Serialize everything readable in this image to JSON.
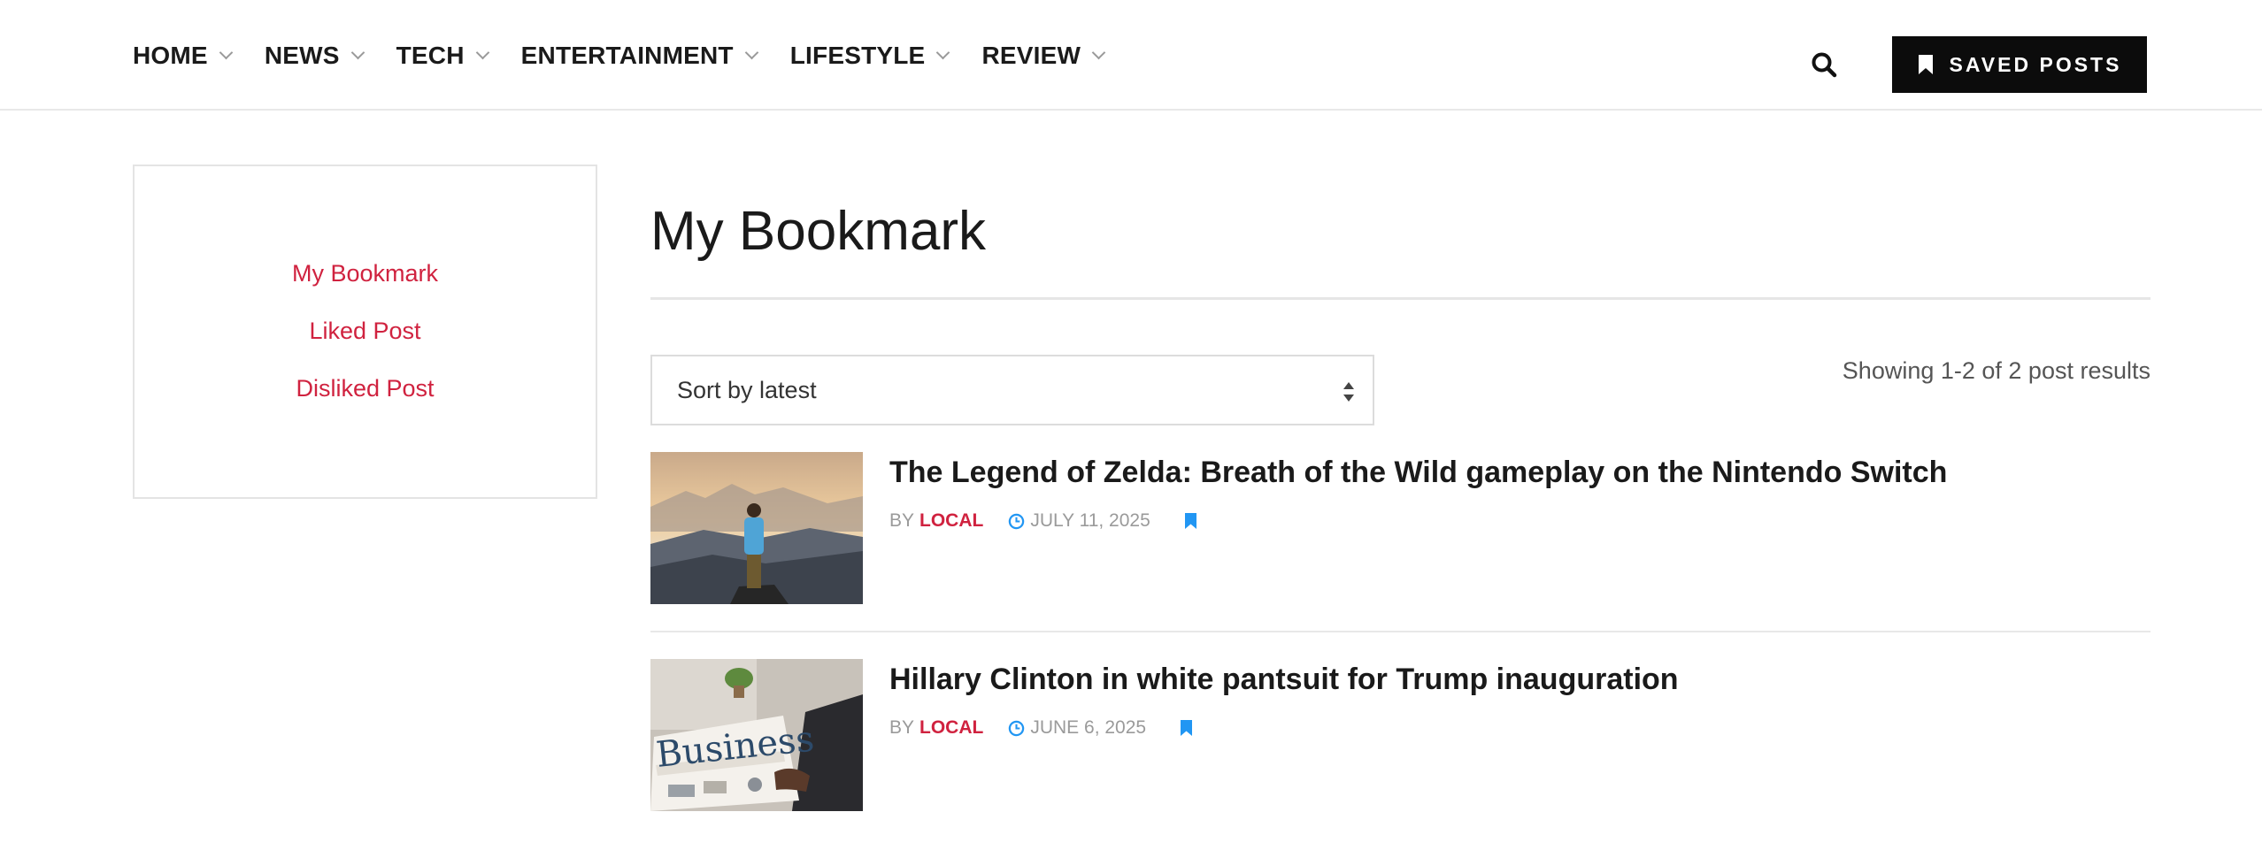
{
  "nav": {
    "items": [
      {
        "label": "HOME"
      },
      {
        "label": "NEWS"
      },
      {
        "label": "TECH"
      },
      {
        "label": "ENTERTAINMENT"
      },
      {
        "label": "LIFESTYLE"
      },
      {
        "label": "REVIEW"
      }
    ],
    "search_icon": "search-icon",
    "saved_posts_label": "SAVED POSTS"
  },
  "sidebar": {
    "links": [
      {
        "label": "My Bookmark"
      },
      {
        "label": "Liked Post"
      },
      {
        "label": "Disliked Post"
      }
    ]
  },
  "main": {
    "title": "My Bookmark",
    "sort_label": "Sort by latest",
    "results_text": "Showing 1-2 of 2 post results",
    "posts": [
      {
        "title": "The Legend of Zelda: Breath of the Wild gameplay on the Nintendo Switch",
        "by": "BY",
        "author": "LOCAL",
        "date": "JULY 11, 2025",
        "thumb_text": ""
      },
      {
        "title": "Hillary Clinton in white pantsuit for Trump inauguration",
        "by": "BY",
        "author": "LOCAL",
        "date": "JUNE 6, 2025",
        "thumb_text": "Business"
      }
    ]
  },
  "colors": {
    "accent_red": "#d0223f",
    "bookmark_blue": "#2196f3",
    "button_black": "#0c0c0c"
  }
}
